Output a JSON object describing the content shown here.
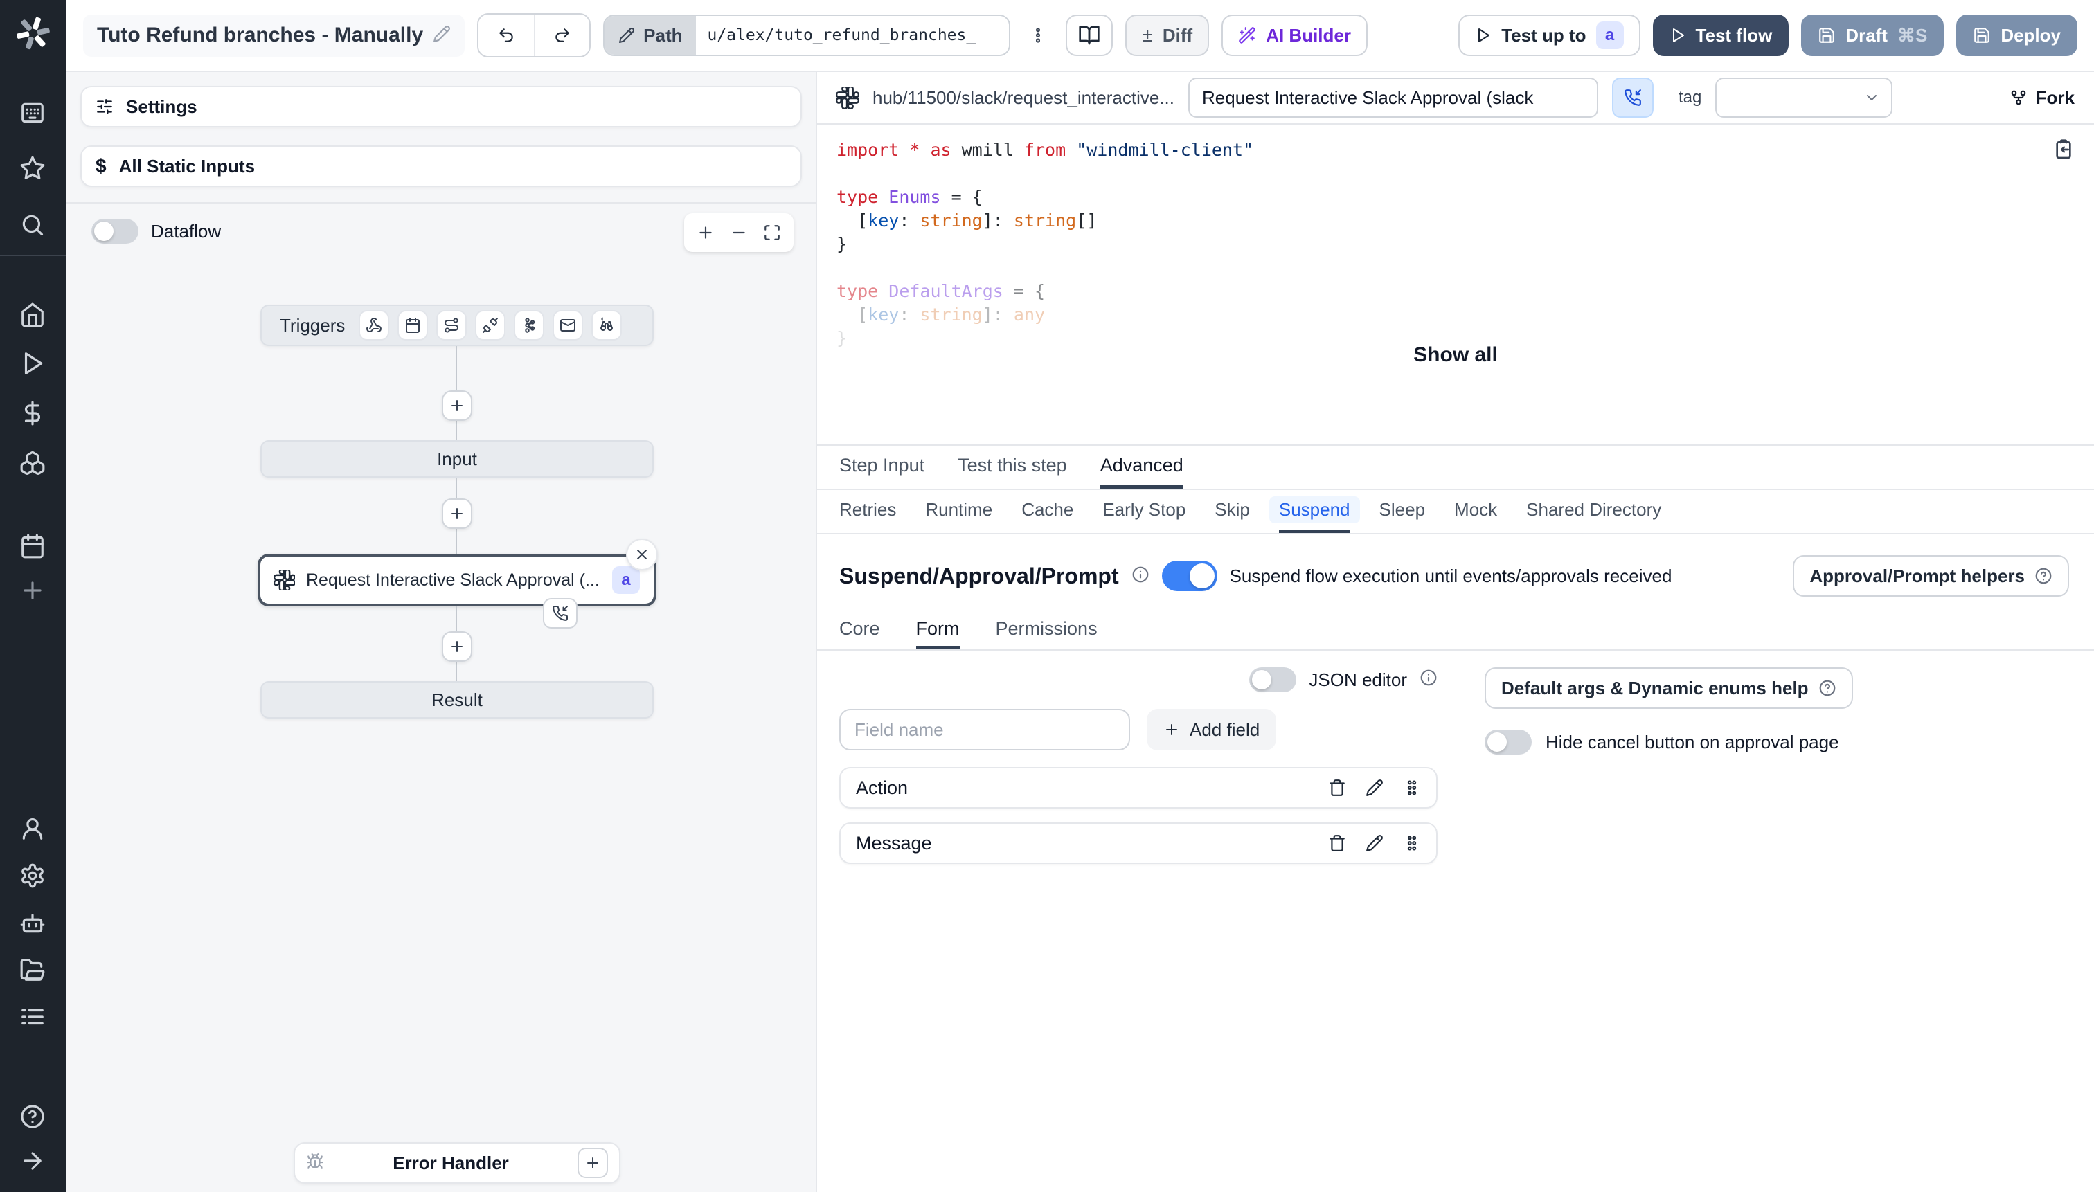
{
  "topbar": {
    "title": "Tuto Refund branches - Manually",
    "path_label": "Path",
    "path_value": "u/alex/tuto_refund_branches_",
    "diff_label": "Diff",
    "diff_glyph": "±",
    "ai_builder_label": "AI Builder",
    "test_up_to_label": "Test up to",
    "test_up_to_badge": "a",
    "test_flow_label": "Test flow",
    "draft_label": "Draft",
    "draft_shortcut": "⌘S",
    "deploy_label": "Deploy"
  },
  "flow_panel": {
    "settings_label": "Settings",
    "static_inputs_icon": "$",
    "static_inputs_label": "All Static Inputs",
    "dataflow_label": "Dataflow",
    "graph": {
      "triggers_label": "Triggers",
      "input_label": "Input",
      "step_label": "Request Interactive Slack Approval (...",
      "step_badge": "a",
      "result_label": "Result",
      "error_handler_label": "Error Handler"
    }
  },
  "step_panel": {
    "hub_path": "hub/11500/slack/request_interactive...",
    "summary_value": "Request Interactive Slack Approval (slack",
    "tag_label": "tag",
    "fork_label": "Fork",
    "show_all_label": "Show all",
    "code_lines": [
      {
        "fade": 0,
        "segs": [
          [
            "import ",
            "k"
          ],
          [
            "* ",
            "k"
          ],
          [
            "as ",
            "k"
          ],
          [
            "wmill ",
            "p"
          ],
          [
            "from ",
            "k"
          ],
          [
            "\"windmill-client\"",
            "s"
          ]
        ]
      },
      {
        "fade": 0,
        "segs": []
      },
      {
        "fade": 0,
        "segs": [
          [
            "type ",
            "k"
          ],
          [
            "Enums ",
            "t"
          ],
          [
            "= {",
            "p"
          ]
        ]
      },
      {
        "fade": 0,
        "segs": [
          [
            "  [",
            "p"
          ],
          [
            "key",
            "v"
          ],
          [
            ": ",
            "p"
          ],
          [
            "string",
            "b"
          ],
          [
            "]: ",
            "p"
          ],
          [
            "string",
            "b"
          ],
          [
            "[]",
            "p"
          ]
        ]
      },
      {
        "fade": 0,
        "segs": [
          [
            "}",
            "p"
          ]
        ]
      },
      {
        "fade": 0,
        "segs": []
      },
      {
        "fade": 1,
        "segs": [
          [
            "type ",
            "k"
          ],
          [
            "DefaultArgs ",
            "t"
          ],
          [
            "= {",
            "p"
          ]
        ]
      },
      {
        "fade": 2,
        "segs": [
          [
            "  [",
            "p"
          ],
          [
            "key",
            "v"
          ],
          [
            ": ",
            "p"
          ],
          [
            "string",
            "b"
          ],
          [
            "]: ",
            "p"
          ],
          [
            "any",
            "b"
          ]
        ]
      },
      {
        "fade": 3,
        "segs": [
          [
            "}",
            "p"
          ]
        ]
      }
    ],
    "tabs": {
      "items": [
        "Step Input",
        "Test this step",
        "Advanced"
      ],
      "active": "Advanced"
    },
    "advanced_tabs": {
      "items": [
        "Retries",
        "Runtime",
        "Cache",
        "Early Stop",
        "Skip",
        "Suspend",
        "Sleep",
        "Mock",
        "Shared Directory"
      ],
      "active": "Suspend"
    },
    "suspend": {
      "heading": "Suspend/Approval/Prompt",
      "toggle_on": true,
      "description": "Suspend flow execution until events/approvals received",
      "helpers_label": "Approval/Prompt helpers",
      "sub_tabs": {
        "items": [
          "Core",
          "Form",
          "Permissions"
        ],
        "active": "Form"
      },
      "form": {
        "json_editor_label": "JSON editor",
        "field_placeholder": "Field name",
        "add_field_label": "Add field",
        "fields": [
          "Action",
          "Message"
        ],
        "default_args_label": "Default args & Dynamic enums help",
        "hide_cancel_label": "Hide cancel button on approval page"
      }
    }
  },
  "colors": {
    "accent_blue": "#3b82f6",
    "active_tab_blue": "#2563eb",
    "badge_bg": "#e0e7ff",
    "badge_text": "#4f46e5",
    "dark_button": "#3b4a63",
    "slate_button": "#7b90ac",
    "sidebar_bg": "#1e242c",
    "ai_purple": "#6d28d9"
  }
}
